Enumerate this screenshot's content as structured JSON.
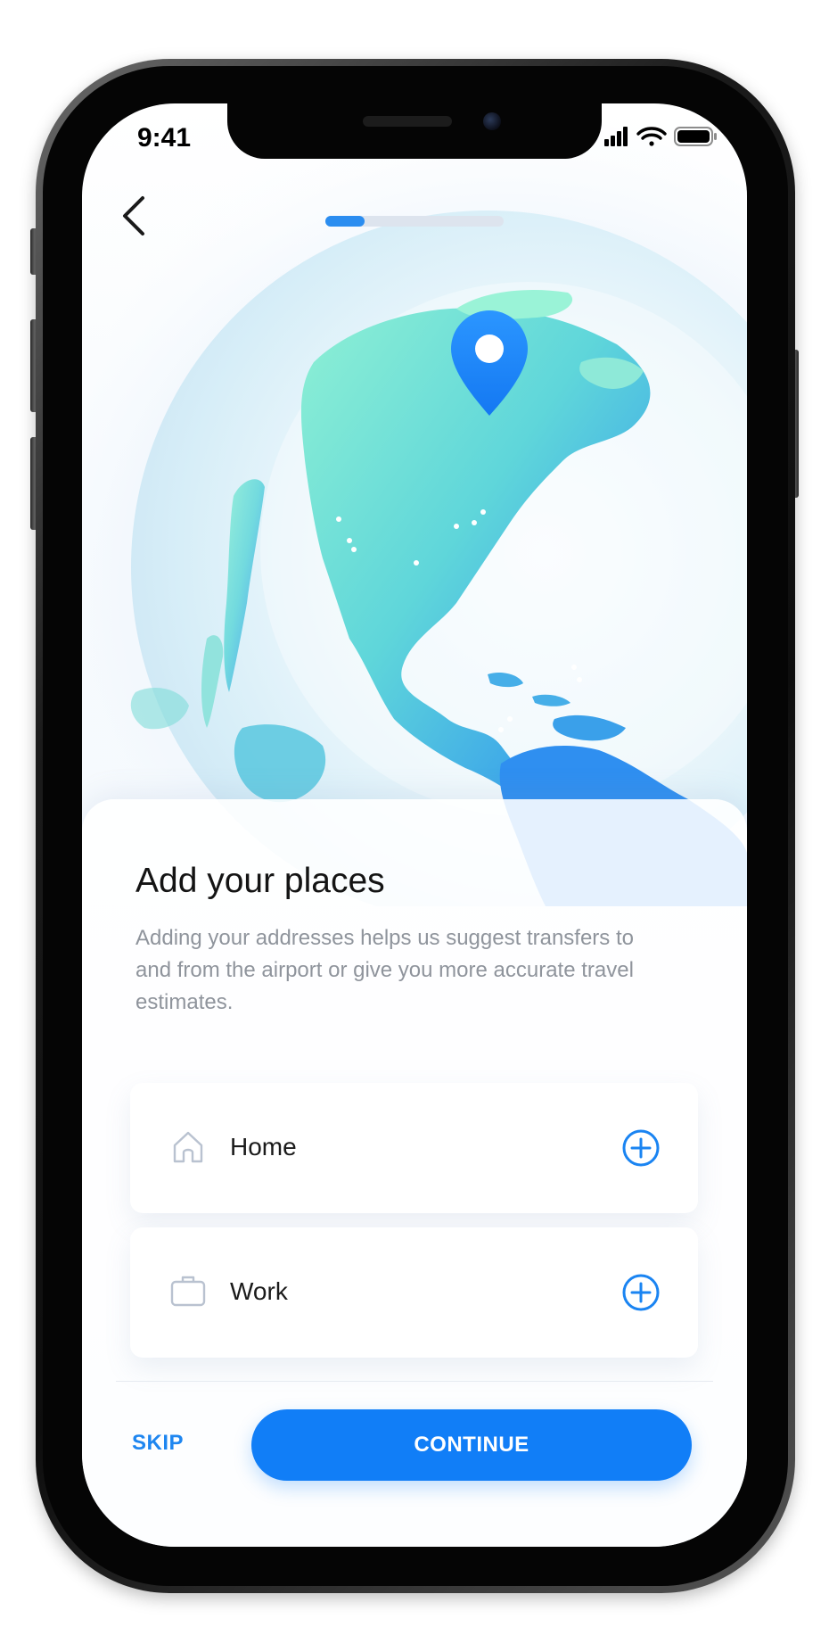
{
  "status_bar": {
    "time": "9:41"
  },
  "progress": {
    "fraction": 0.22,
    "color": "#2b8df0"
  },
  "onboarding": {
    "title": "Add your places",
    "description": "Adding your addresses helps us suggest transfers to and from the airport or give you more accurate travel estimates."
  },
  "places": [
    {
      "label": "Home",
      "icon": "home-icon",
      "action_icon": "add-circle-icon"
    },
    {
      "label": "Work",
      "icon": "briefcase-icon",
      "action_icon": "add-circle-icon"
    }
  ],
  "footer": {
    "skip_label": "SKIP",
    "continue_label": "CONTINUE"
  },
  "colors": {
    "accent": "#117ef7",
    "skip_text": "#1e86f0",
    "title_text": "#141414",
    "description_text": "#8f949c",
    "pin": "#1d8cf8"
  }
}
